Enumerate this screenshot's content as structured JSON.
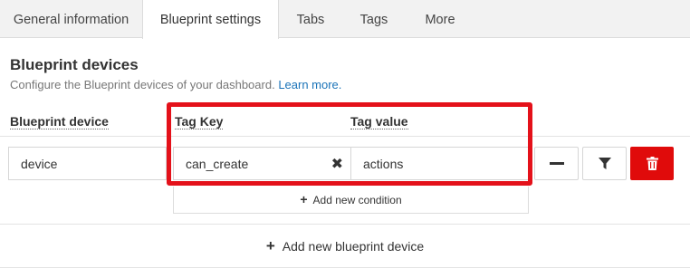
{
  "tabs": [
    {
      "label": "General information"
    },
    {
      "label": "Blueprint settings"
    },
    {
      "label": "Tabs"
    },
    {
      "label": "Tags"
    },
    {
      "label": "More"
    }
  ],
  "section": {
    "title": "Blueprint devices",
    "description": "Configure the Blueprint devices of your dashboard.",
    "learn_more": "Learn more."
  },
  "columns": {
    "device": "Blueprint device",
    "tag_key": "Tag Key",
    "tag_value": "Tag value"
  },
  "row": {
    "device": "device",
    "tag_key": "can_create",
    "tag_value": "actions"
  },
  "add_condition_label": "Add new condition",
  "add_device_label": "Add new blueprint device",
  "colors": {
    "highlight": "#e4111a",
    "delete_button": "#e00b0b",
    "link": "#1a73b8"
  }
}
